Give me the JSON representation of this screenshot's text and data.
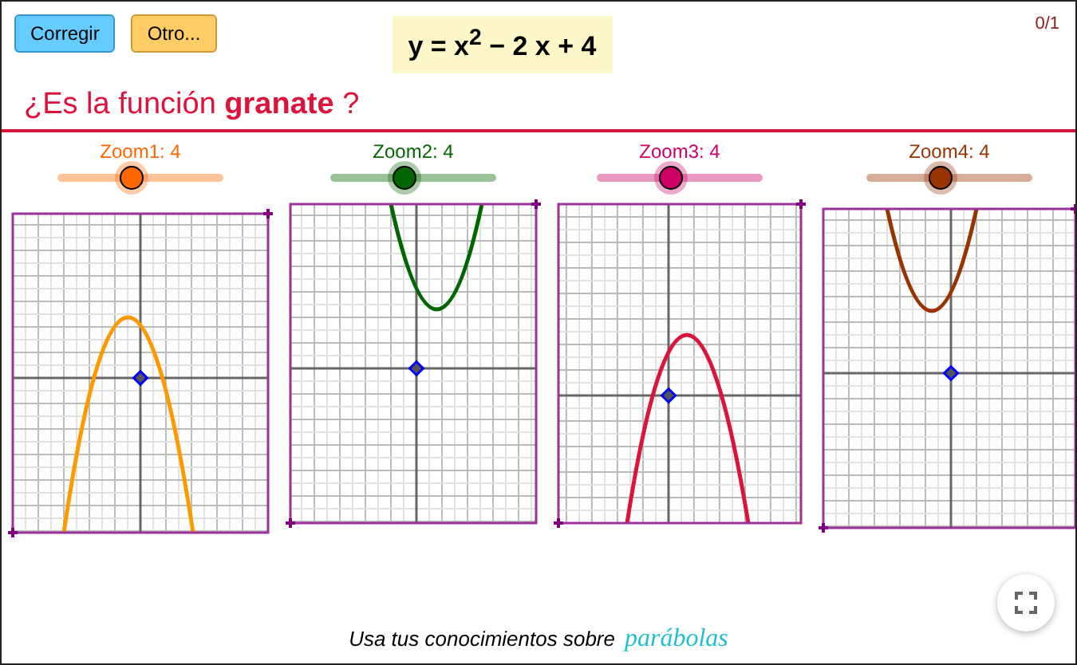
{
  "buttons": [
    {
      "label": "Corregir",
      "kind": "check"
    },
    {
      "label": "Otro...",
      "kind": "other"
    }
  ],
  "formula": "y = x$^{2}$ − 2 x + 4",
  "score": "0/1",
  "question": "¿Es la función **granate** ?",
  "graphs": [
    {
      "zoom_label": "Zoom1: 4",
      "level": 0.45,
      "color": "#ff6600",
      "curve": {
        "color": "#ff9900"
      }
    },
    {
      "zoom_label": "Zoom2: 4",
      "level": 0.45,
      "color": "#006600",
      "curve": {
        "color": "#006600"
      }
    },
    {
      "zoom_label": "Zoom3: 4",
      "level": 0.45,
      "color": "#cc0066",
      "curve": {
        "color": "#dc143c"
      }
    },
    {
      "zoom_label": "Zoom4: 4",
      "level": 0.45,
      "color": "#993300",
      "curve": {
        "color": "#993300"
      }
    }
  ],
  "footer": {
    "text": "Usa tus conocimientos sobre",
    "link": "parábolas"
  }
}
